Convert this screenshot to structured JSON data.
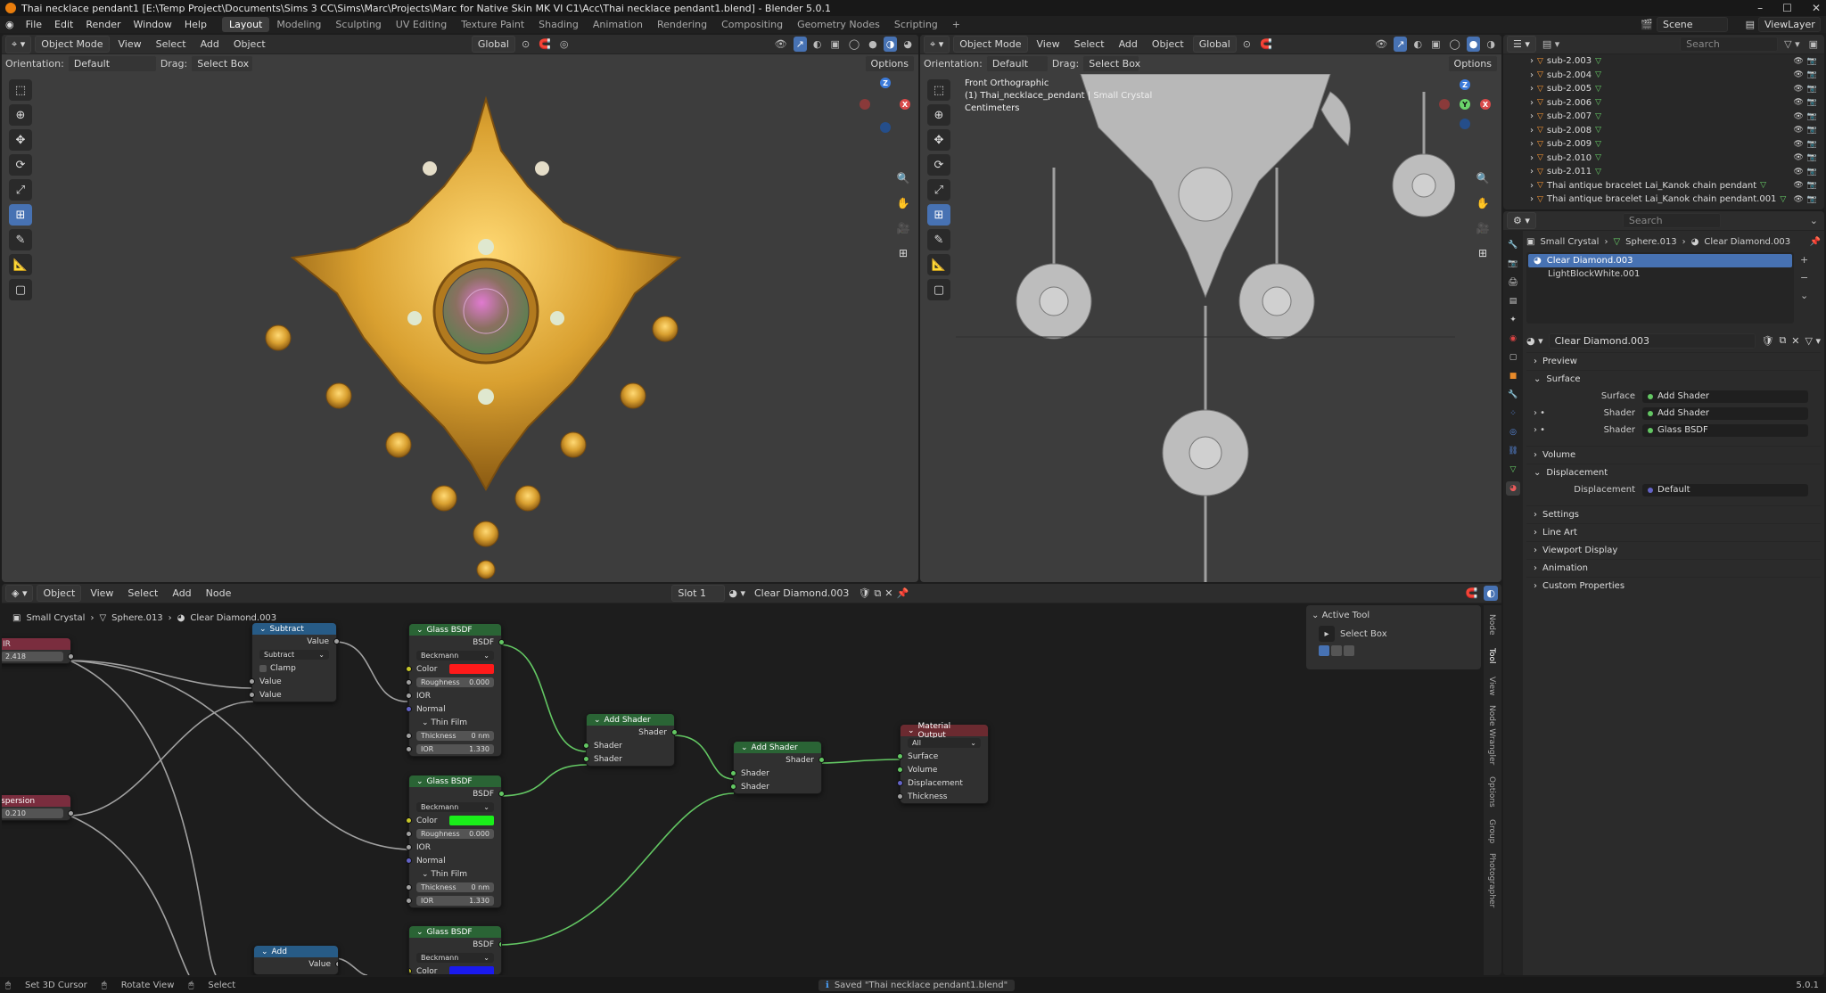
{
  "window": {
    "title": "Thai necklace pendant1 [E:\\Temp Project\\Documents\\Sims 3 CC\\Sims\\Marc\\Projects\\Marc for Native Skin MK VI C1\\Acc\\Thai necklace pendant1.blend] - Blender 5.0.1"
  },
  "menubar": {
    "menus": [
      "File",
      "Edit",
      "Render",
      "Window",
      "Help"
    ],
    "workspaces": [
      "Layout",
      "Modeling",
      "Sculpting",
      "UV Editing",
      "Texture Paint",
      "Shading",
      "Animation",
      "Rendering",
      "Compositing",
      "Geometry Nodes",
      "Scripting"
    ],
    "active_workspace": "Layout",
    "scene": "Scene",
    "view_layer": "ViewLayer"
  },
  "viewport_left": {
    "mode": "Object Mode",
    "menus": [
      "View",
      "Select",
      "Add",
      "Object"
    ],
    "transform": "Global",
    "orientation_label": "Orientation:",
    "orientation": "Default",
    "drag_label": "Drag:",
    "drag": "Select Box",
    "options": "Options"
  },
  "viewport_right": {
    "mode": "Object Mode",
    "menus": [
      "View",
      "Select",
      "Add",
      "Object"
    ],
    "transform": "Global",
    "orientation_label": "Orientation:",
    "orientation": "Default",
    "drag_label": "Drag:",
    "drag": "Select Box",
    "options": "Options",
    "overlay_view": "Front Orthographic",
    "overlay_object": "(1) Thai_necklace_pendant | Small Crystal",
    "overlay_units": "Centimeters"
  },
  "node_editor": {
    "mode": "Object",
    "menus": [
      "View",
      "Select",
      "Add",
      "Node"
    ],
    "slot": "Slot 1",
    "material": "Clear Diamond.003",
    "breadcrumb": [
      "Small Crystal",
      "Sphere.013",
      "Clear Diamond.003"
    ],
    "active_tool_title": "Active Tool",
    "active_tool": "Select Box",
    "side_tabs": [
      "Node",
      "Tool",
      "View",
      "Node Wrangler",
      "Options",
      "Group",
      "Photographer"
    ],
    "nodes": {
      "ior_value": "2.418",
      "dispersion_label": "spersion",
      "dispersion_value": "0.210",
      "subtract": {
        "title": "Subtract",
        "out": "Value",
        "op": "Subtract",
        "clamp": "Clamp",
        "in1": "Value",
        "in2": "Value"
      },
      "glass1": {
        "title": "Glass BSDF",
        "out": "BSDF",
        "dist": "Beckmann",
        "color": "Color",
        "color_hex": "#ff1a1a",
        "roughness": "Roughness",
        "roughness_val": "0.000",
        "ior": "IOR",
        "normal": "Normal",
        "thin_film": "Thin Film",
        "thickness": "Thickness",
        "thickness_val": "0 nm",
        "ior2": "IOR",
        "ior2_val": "1.330"
      },
      "glass2": {
        "title": "Glass BSDF",
        "out": "BSDF",
        "dist": "Beckmann",
        "color": "Color",
        "color_hex": "#1aee1a",
        "roughness": "Roughness",
        "roughness_val": "0.000",
        "ior": "IOR",
        "normal": "Normal",
        "thin_film": "Thin Film",
        "thickness": "Thickness",
        "thickness_val": "0 nm",
        "ior2": "IOR",
        "ior2_val": "1.330"
      },
      "glass3": {
        "title": "Glass BSDF",
        "out": "BSDF",
        "dist": "Beckmann",
        "color": "Color",
        "color_hex": "#1a1aee"
      },
      "add_shader1": {
        "title": "Add Shader",
        "out": "Shader",
        "in1": "Shader",
        "in2": "Shader"
      },
      "add_shader2": {
        "title": "Add Shader",
        "out": "Shader",
        "in1": "Shader",
        "in2": "Shader"
      },
      "output": {
        "title": "Material Output",
        "target": "All",
        "surface": "Surface",
        "volume": "Volume",
        "displacement": "Displacement",
        "thickness": "Thickness"
      },
      "add": {
        "title": "Add",
        "out": "Value"
      }
    }
  },
  "outliner": {
    "search_placeholder": "Search",
    "items": [
      "sub-2.003",
      "sub-2.004",
      "sub-2.005",
      "sub-2.006",
      "sub-2.007",
      "sub-2.008",
      "sub-2.009",
      "sub-2.010",
      "sub-2.011",
      "Thai antique bracelet Lai_Kanok chain pendant",
      "Thai antique bracelet Lai_Kanok chain pendant.001"
    ]
  },
  "properties": {
    "search_placeholder": "Search",
    "breadcrumb": [
      "Small Crystal",
      "Sphere.013",
      "Clear Diamond.003"
    ],
    "material_slots": [
      "Clear Diamond.003",
      "LightBlockWhite.001"
    ],
    "material_name": "Clear Diamond.003",
    "panels": {
      "preview": "Preview",
      "surface": "Surface",
      "surface_label": "Surface",
      "surface_value": "Add Shader",
      "shader1_label": "Shader",
      "shader1_value": "Add Shader",
      "shader2_label": "Shader",
      "shader2_value": "Glass BSDF",
      "volume": "Volume",
      "displacement": "Displacement",
      "displacement_label": "Displacement",
      "displacement_value": "Default",
      "settings": "Settings",
      "line_art": "Line Art",
      "viewport_display": "Viewport Display",
      "animation": "Animation",
      "custom_properties": "Custom Properties"
    }
  },
  "statusbar": {
    "hint1": "Set 3D Cursor",
    "hint2": "Rotate View",
    "hint3": "Select",
    "message": "Saved \"Thai necklace pendant1.blend\"",
    "version": "5.0.1"
  },
  "colors": {
    "accent": "#4772b3",
    "gold": "#d9a030",
    "shader_header": "#2a6435",
    "math_header": "#275b86",
    "output_header": "#6b2a30"
  }
}
